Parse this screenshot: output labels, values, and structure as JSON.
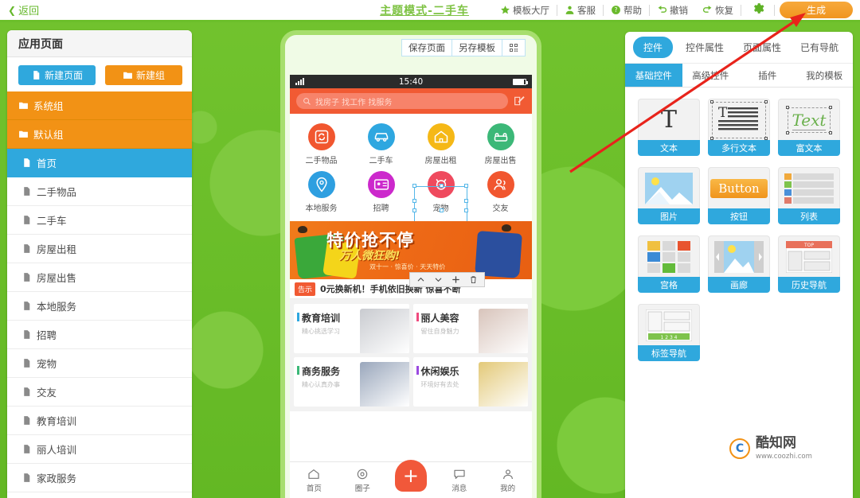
{
  "topbar": {
    "back_label": "返回",
    "title": "主题模式-二手车",
    "actions": [
      {
        "label": "模板大厅",
        "icon": "star-icon"
      },
      {
        "label": "客服",
        "icon": "user-icon"
      },
      {
        "label": "帮助",
        "icon": "question-icon"
      },
      {
        "label": "撤销",
        "icon": "undo-icon"
      },
      {
        "label": "恢复",
        "icon": "redo-icon"
      }
    ],
    "settings_icon": "gear-icon",
    "generate_label": "生成",
    "accent_green": "#7dc242",
    "accent_orange": "#f0951f"
  },
  "sidebar": {
    "header": "应用页面",
    "new_page_label": "新建页面",
    "new_group_label": "新建组",
    "items": [
      {
        "label": "系统组",
        "type": "group"
      },
      {
        "label": "默认组",
        "type": "group"
      },
      {
        "label": "首页",
        "type": "page",
        "active": true
      },
      {
        "label": "二手物品",
        "type": "page"
      },
      {
        "label": "二手车",
        "type": "page"
      },
      {
        "label": "房屋出租",
        "type": "page"
      },
      {
        "label": "房屋出售",
        "type": "page"
      },
      {
        "label": "本地服务",
        "type": "page"
      },
      {
        "label": "招聘",
        "type": "page"
      },
      {
        "label": "宠物",
        "type": "page"
      },
      {
        "label": "交友",
        "type": "page"
      },
      {
        "label": "教育培训",
        "type": "page"
      },
      {
        "label": "丽人培训",
        "type": "page"
      },
      {
        "label": "家政服务",
        "type": "page"
      }
    ]
  },
  "preview": {
    "toolbar": [
      {
        "label": "保存页面",
        "icon": "save-icon"
      },
      {
        "label": "另存模板",
        "icon": "template-icon"
      },
      {
        "label": "",
        "icon": "qrcode-icon"
      }
    ],
    "status_time": "15:40",
    "search_placeholder": "找房子 找工作 找服务",
    "grid": [
      {
        "label": "二手物品",
        "color": "#f1562f",
        "icon": "refresh-box-icon"
      },
      {
        "label": "二手车",
        "color": "#2ea7e0",
        "icon": "car-icon"
      },
      {
        "label": "房屋出租",
        "color": "#f5b816",
        "icon": "house-icon"
      },
      {
        "label": "房屋出售",
        "color": "#3cb878",
        "icon": "sofa-icon"
      },
      {
        "label": "本地服务",
        "color": "#2e9fe0",
        "icon": "location-icon"
      },
      {
        "label": "招聘",
        "color": "#cc29cc",
        "icon": "id-card-icon"
      },
      {
        "label": "宠物",
        "color": "#ef4a5e",
        "icon": "pet-icon",
        "selected": true
      },
      {
        "label": "交友",
        "color": "#f1562f",
        "icon": "friends-icon"
      }
    ],
    "float_toolbar": [
      {
        "icon": "chevron-up-icon"
      },
      {
        "icon": "chevron-down-icon"
      },
      {
        "icon": "plus-icon"
      },
      {
        "icon": "trash-icon"
      }
    ],
    "banner": {
      "title": "特价抢不停",
      "subtitle": "万人微狂购!",
      "subtitle2": "双十一 · 惊喜价 · 天天特价"
    },
    "notice": {
      "tag": "告示",
      "text": "0元换新机！手机依旧换新 惊喜不断"
    },
    "cards": [
      {
        "title": "教育培训",
        "sub": "精心挑选学习",
        "bar": "#2ea7e0",
        "img": "#c9cbd0"
      },
      {
        "title": "丽人美容",
        "sub": "留住自身魅力",
        "bar": "#ef4a7e",
        "img": "#d8c4bb"
      },
      {
        "title": "商务服务",
        "sub": "精心认真办事",
        "bar": "#3cb878",
        "img": "#9aa7bc"
      },
      {
        "title": "休闲娱乐",
        "sub": "环境好有去处",
        "bar": "#9b4ae0",
        "img": "#e3c978"
      }
    ],
    "tabbar": [
      {
        "label": "首页",
        "icon": "home-icon"
      },
      {
        "label": "圈子",
        "icon": "circle-icon"
      },
      {
        "label": "",
        "icon": "plus-icon"
      },
      {
        "label": "消息",
        "icon": "message-icon"
      },
      {
        "label": "我的",
        "icon": "profile-icon"
      }
    ]
  },
  "rightpanel": {
    "tabs": [
      {
        "label": "控件",
        "active": true
      },
      {
        "label": "控件属性",
        "active": false
      },
      {
        "label": "页面属性",
        "active": false
      },
      {
        "label": "已有导航",
        "active": false
      }
    ],
    "subtabs": [
      {
        "label": "基础控件",
        "active": true
      },
      {
        "label": "高级控件",
        "active": false
      },
      {
        "label": "插件",
        "active": false
      },
      {
        "label": "我的模板",
        "active": false
      }
    ],
    "widgets": [
      {
        "label": "文本",
        "thumb": "text-T"
      },
      {
        "label": "多行文本",
        "thumb": "multiline-text"
      },
      {
        "label": "富文本",
        "thumb": "rich-text"
      },
      {
        "label": "图片",
        "thumb": "image"
      },
      {
        "label": "按钮",
        "thumb": "button",
        "btn_text": "Button"
      },
      {
        "label": "列表",
        "thumb": "list"
      },
      {
        "label": "宫格",
        "thumb": "grid"
      },
      {
        "label": "画廊",
        "thumb": "gallery"
      },
      {
        "label": "历史导航",
        "thumb": "history-nav",
        "top_text": "TOP"
      },
      {
        "label": "标签导航",
        "thumb": "tab-nav",
        "nums": "1  2  3  4"
      }
    ]
  },
  "annotation": {
    "arrow_color": "#e8231b"
  },
  "watermark": {
    "logo_letter": "C",
    "name": "酷知网",
    "url": "www.coozhi.com"
  }
}
